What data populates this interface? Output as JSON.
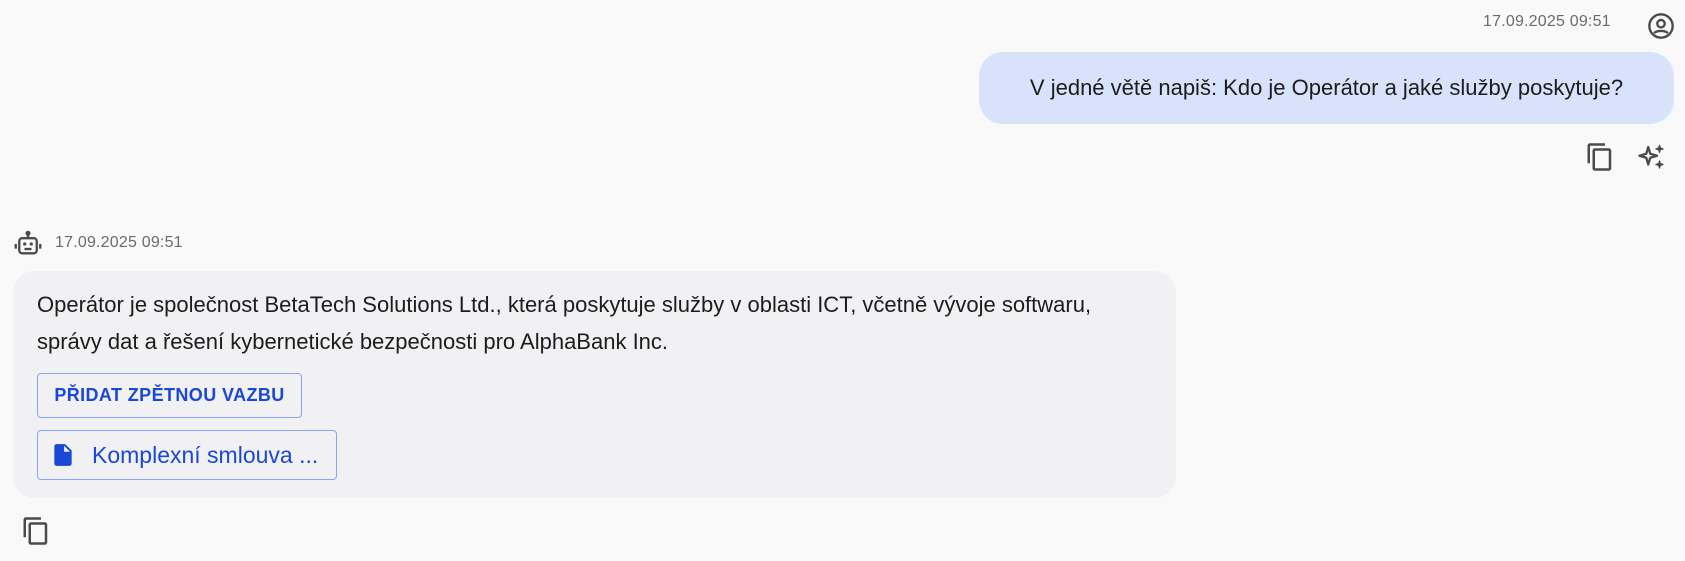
{
  "user_message": {
    "timestamp": "17.09.2025 09:51",
    "text": "V jedné větě napiš: Kdo je Operátor a jaké služby poskytuje?",
    "avatar_icon": "account-circle-icon",
    "actions": [
      {
        "icon": "copy-icon"
      },
      {
        "icon": "sparkle-icon"
      }
    ]
  },
  "assistant_message": {
    "timestamp": "17.09.2025 09:51",
    "avatar_icon": "robot-icon",
    "text": "Operátor je společnost BetaTech Solutions Ltd., která poskytuje služby v oblasti ICT, včetně vývoje softwaru, správy dat a řešení kybernetické bezpečnosti pro AlphaBank Inc.",
    "feedback_label": "PŘIDAT ZPĚTNOU VAZBU",
    "source_document": {
      "label": "Komplexní smlouva ...",
      "icon": "document-icon"
    },
    "actions": [
      {
        "icon": "copy-icon"
      }
    ]
  },
  "colors": {
    "background": "#f9f9f9",
    "user_bubble": "#d8e3fb",
    "assistant_bubble": "#f1f1f4",
    "accent": "#1947d6"
  }
}
